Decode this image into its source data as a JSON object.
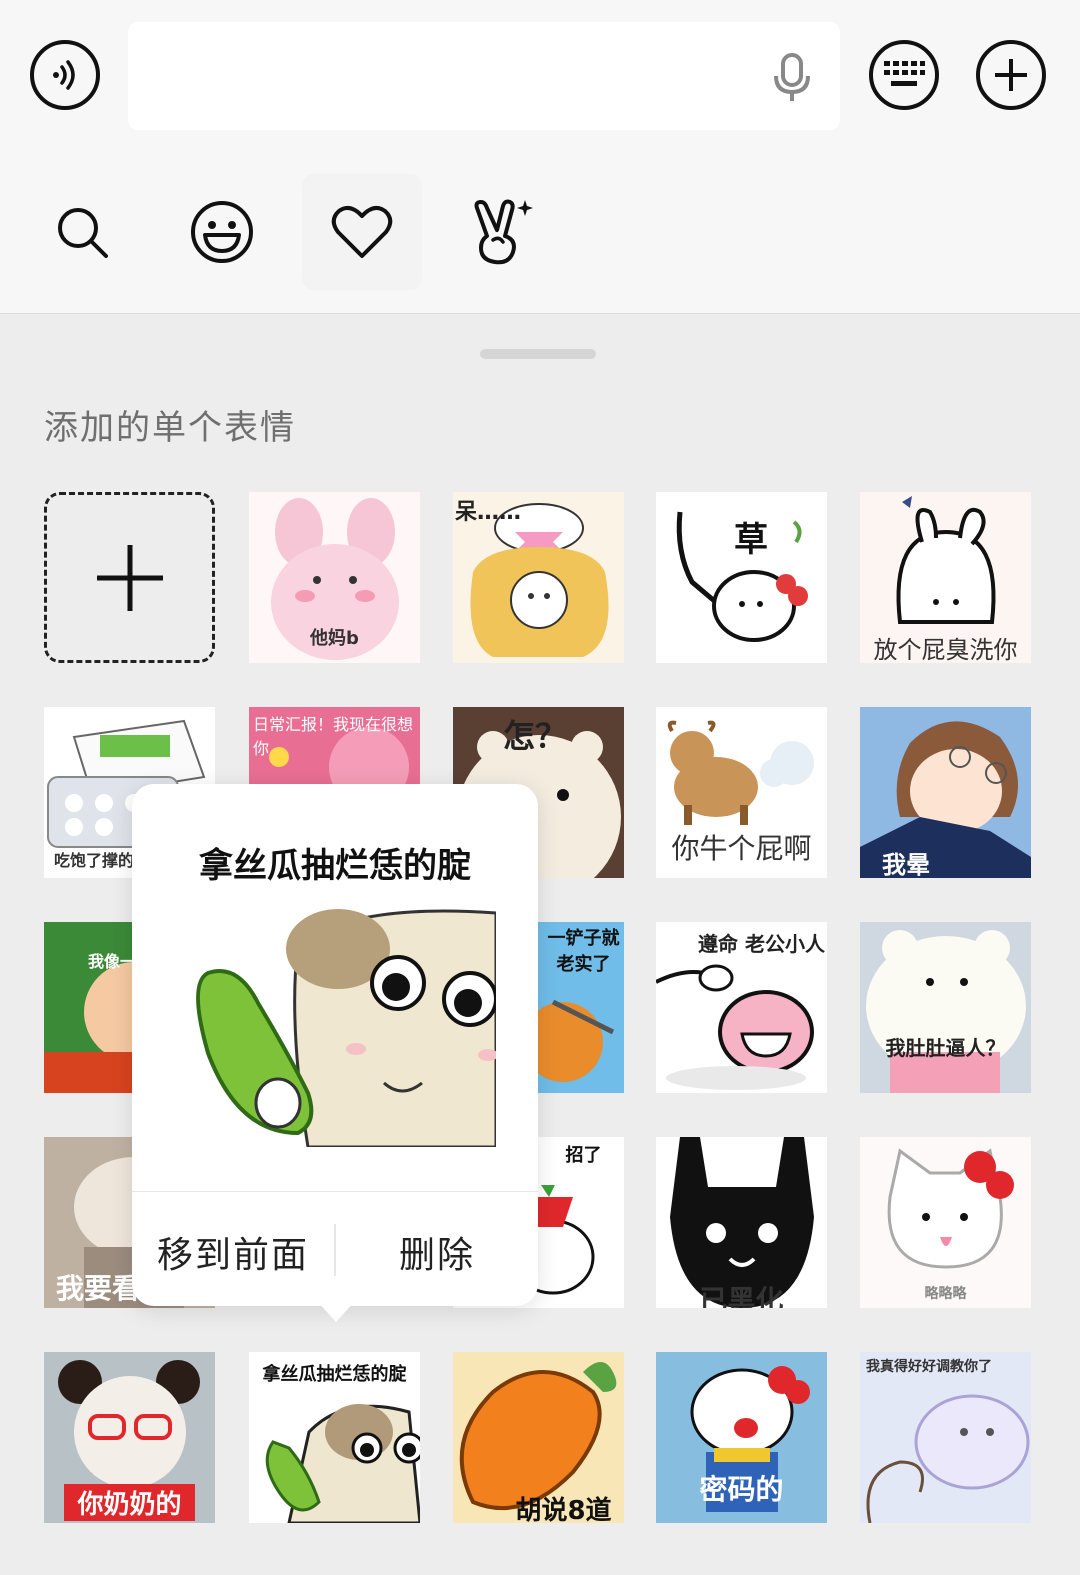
{
  "input_bar": {
    "voice_icon": "voice-icon",
    "mic_icon": "mic-icon",
    "keyboard_icon": "keyboard-icon",
    "plus_icon": "plus-icon"
  },
  "toolbar": {
    "tabs": [
      "search-icon",
      "emoji-icon",
      "heart-icon",
      "hand-gesture-icon"
    ],
    "active_tab": "heart-icon"
  },
  "section": {
    "title": "添加的单个表情"
  },
  "stickers": {
    "r1": [
      "",
      "他妈b",
      "呆……",
      "草",
      "放个屁臭洗你"
    ],
    "r2": [
      "吃饱了撑的",
      "日常汇报！我现在很想你",
      "怎？",
      "你牛个屁啊",
      "我晕"
    ],
    "r3": [
      "我像一",
      "一铲子就老实了",
      "遵命 老公小人",
      "我肚肚逼人？"
    ],
    "r4": [
      "我要看",
      "招了",
      "已黑化",
      "略略略"
    ],
    "r5": [
      "你奶奶的",
      "拿丝瓜抽烂恁的腚",
      "胡说8道",
      "密码的",
      "我真得好好调教你了"
    ]
  },
  "popup": {
    "title": "拿丝瓜抽烂恁的腚",
    "move_front": "移到前面",
    "delete": "删除"
  },
  "colors": {
    "accent": "#111111",
    "panel": "#ededed"
  }
}
